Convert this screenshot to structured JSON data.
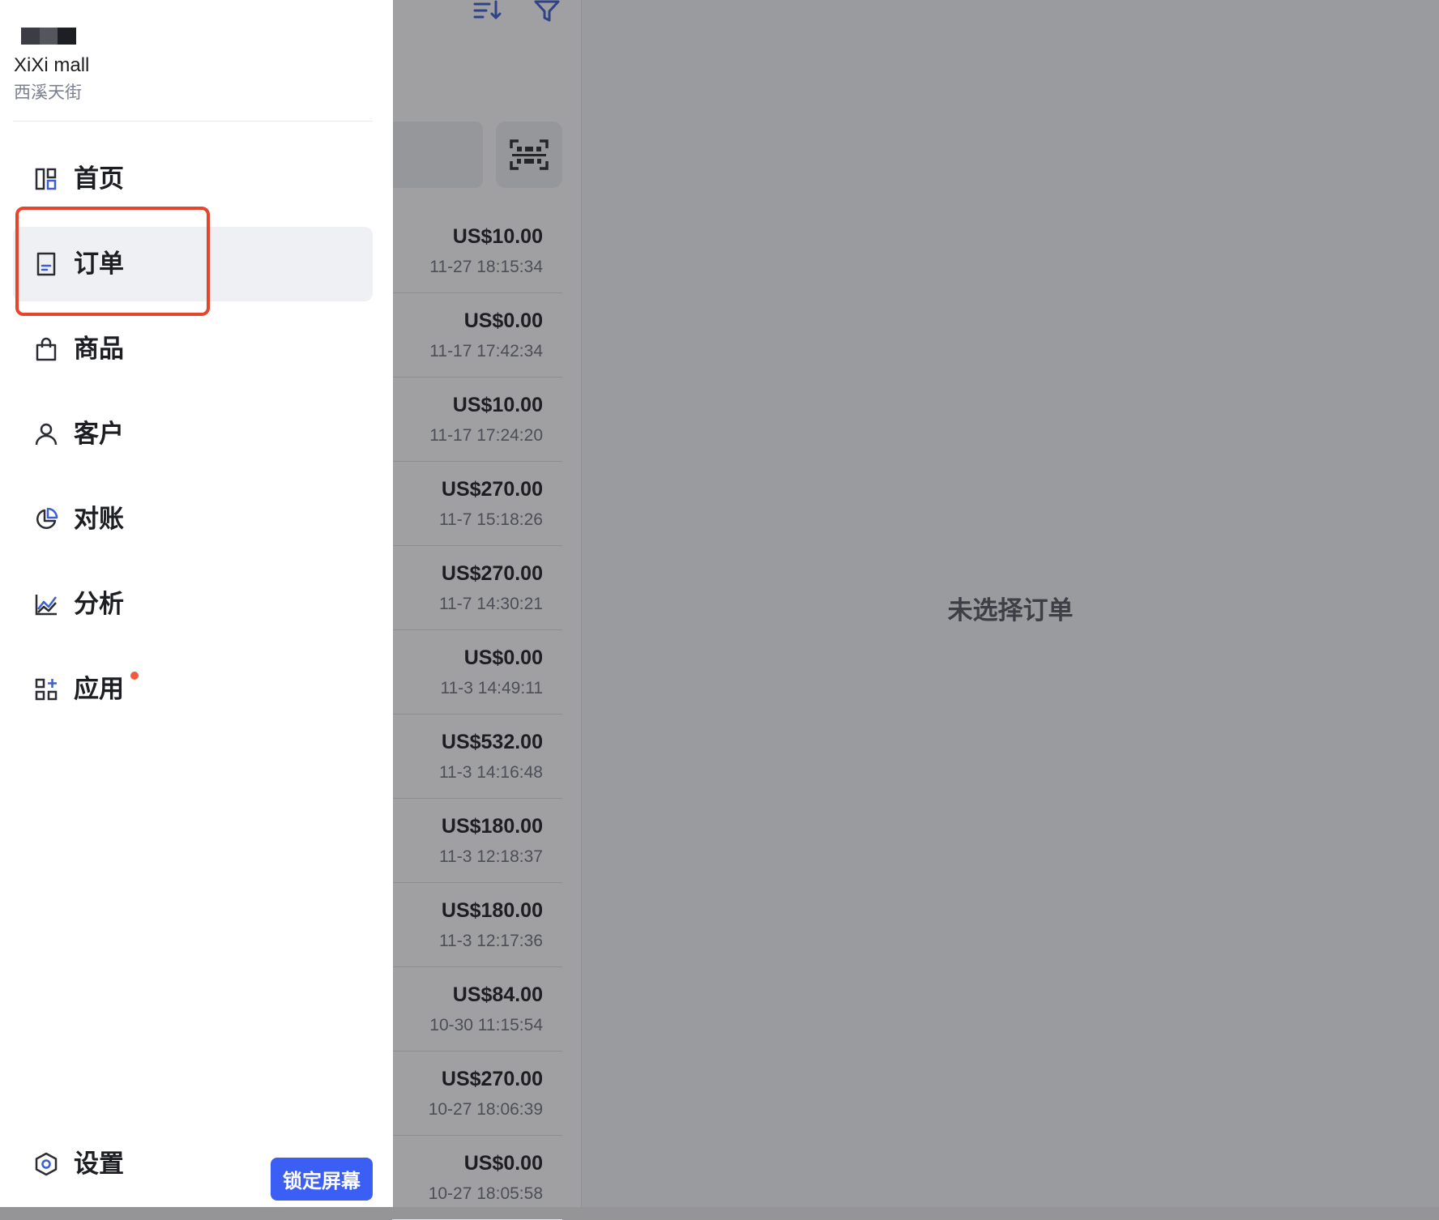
{
  "store": {
    "name": "XiXi mall",
    "subtitle": "西溪天街"
  },
  "nav": {
    "items": [
      {
        "label": "首页",
        "icon": "dashboard-icon",
        "active": false
      },
      {
        "label": "订单",
        "icon": "order-document-icon",
        "active": true
      },
      {
        "label": "商品",
        "icon": "shopping-bag-icon",
        "active": false
      },
      {
        "label": "客户",
        "icon": "user-icon",
        "active": false
      },
      {
        "label": "对账",
        "icon": "pie-chart-icon",
        "active": false
      },
      {
        "label": "分析",
        "icon": "line-chart-icon",
        "active": false
      },
      {
        "label": "应用",
        "icon": "apps-grid-icon",
        "active": false,
        "badge_dot": true
      }
    ],
    "settings_label": "设置",
    "lock_screen_label": "锁定屏幕"
  },
  "orders": [
    {
      "amount": "US$10.00",
      "time": "11-27 18:15:34"
    },
    {
      "amount": "US$0.00",
      "time": "11-17 17:42:34"
    },
    {
      "amount": "US$10.00",
      "time": "11-17 17:24:20"
    },
    {
      "amount": "US$270.00",
      "time": "11-7 15:18:26"
    },
    {
      "amount": "US$270.00",
      "time": "11-7 14:30:21"
    },
    {
      "amount": "US$0.00",
      "time": "11-3 14:49:11"
    },
    {
      "amount": "US$532.00",
      "time": "11-3 14:16:48"
    },
    {
      "amount": "US$180.00",
      "time": "11-3 12:18:37"
    },
    {
      "amount": "US$180.00",
      "time": "11-3 12:17:36"
    },
    {
      "amount": "US$84.00",
      "time": "10-30 11:15:54"
    },
    {
      "amount": "US$270.00",
      "time": "10-27 18:06:39"
    },
    {
      "amount": "US$0.00",
      "time": "10-27 18:05:58"
    }
  ],
  "detail": {
    "empty_text": "未选择订单"
  },
  "colors": {
    "accent": "#3b5ff5",
    "highlight": "#e8432b",
    "badge": "#ef5b3f",
    "icon_blue": "#3d5fcf"
  }
}
